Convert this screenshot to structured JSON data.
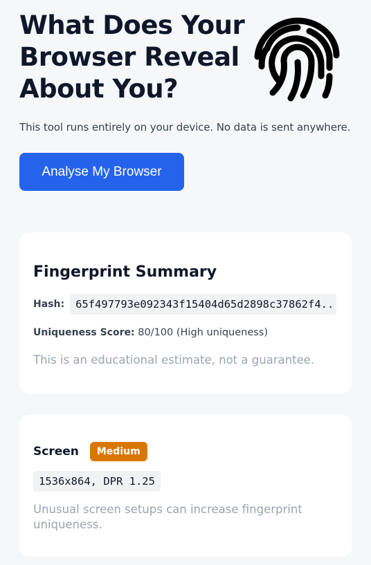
{
  "hero": {
    "title": "What Does Your\nBrowser Reveal\nAbout You?",
    "subtitle": "This tool runs entirely on your device. No data is sent anywhere.",
    "cta_label": "Analyse My Browser",
    "icon": "fingerprint-icon"
  },
  "summary": {
    "title": "Fingerprint Summary",
    "hash_label": "Hash:",
    "hash_value": "65f497793e092343f15404d65d2898c37862f4...",
    "score_label": "Uniqueness Score:",
    "score_value": " 80/100 (High uniqueness)",
    "note": "This is an educational estimate, not a guarantee."
  },
  "screen": {
    "title": "Screen",
    "badge": "Medium",
    "value": "1536x864, DPR 1.25",
    "note": "Unusual screen setups can increase fingerprint uniqueness."
  },
  "colors": {
    "accent": "#2563eb",
    "badge_medium": "#d97706",
    "background": "#f6f7f9"
  }
}
